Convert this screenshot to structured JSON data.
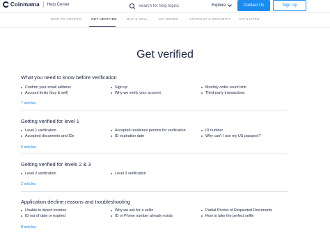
{
  "header": {
    "logo_text": "Coinmama",
    "help_center": "Help Center",
    "search_placeholder": "Search for help topics",
    "explore_label": "Explore",
    "contact_label": "Contact Us",
    "signup_label": "Sign Up"
  },
  "nav": {
    "items": [
      {
        "label": "NEW TO CRYPTO"
      },
      {
        "label": "GET VERIFIED"
      },
      {
        "label": "BUY & SELL"
      },
      {
        "label": "MY ORDER"
      },
      {
        "label": "ACCOUNT & SECURITY"
      },
      {
        "label": "AFFILIATES"
      }
    ]
  },
  "page_title": "Get verified",
  "sections": [
    {
      "title": "What you need to know before verification",
      "columns": [
        [
          "Confirm your email address",
          "Account limits (buy & sell)"
        ],
        [
          "Sign up",
          "Why we verify your account"
        ],
        [
          "Monthly order count limit",
          "Third-party transactions"
        ]
      ],
      "articles": "7 articles"
    },
    {
      "title": "Getting verified for level 1",
      "columns": [
        [
          "Level 1 verification",
          "Accepted documents and IDs"
        ],
        [
          "Accepted residence permits for verification",
          "ID expiration date"
        ],
        [
          "ID number",
          "Why can't I use my US passport?"
        ]
      ],
      "articles": "6 articles"
    },
    {
      "title": "Getting verified for levels 2 & 3",
      "columns": [
        [
          "Level 2 verification"
        ],
        [
          "Level 3 verification"
        ],
        []
      ],
      "articles": "2 articles"
    },
    {
      "title": "Application decline reasons and troubleshooting",
      "columns": [
        [
          "Unable to detect location",
          "ID out of date or expired"
        ],
        [
          "Why we ask for a selfie",
          "ID or Phone number already exists"
        ],
        [
          "Partial Photos of Requested Documents",
          "How to take the perfect selfie"
        ]
      ],
      "articles": "8 articles"
    }
  ],
  "colors": {
    "accent": "#1a8cf0",
    "text": "#1a2340",
    "muted": "#8a90a6"
  }
}
